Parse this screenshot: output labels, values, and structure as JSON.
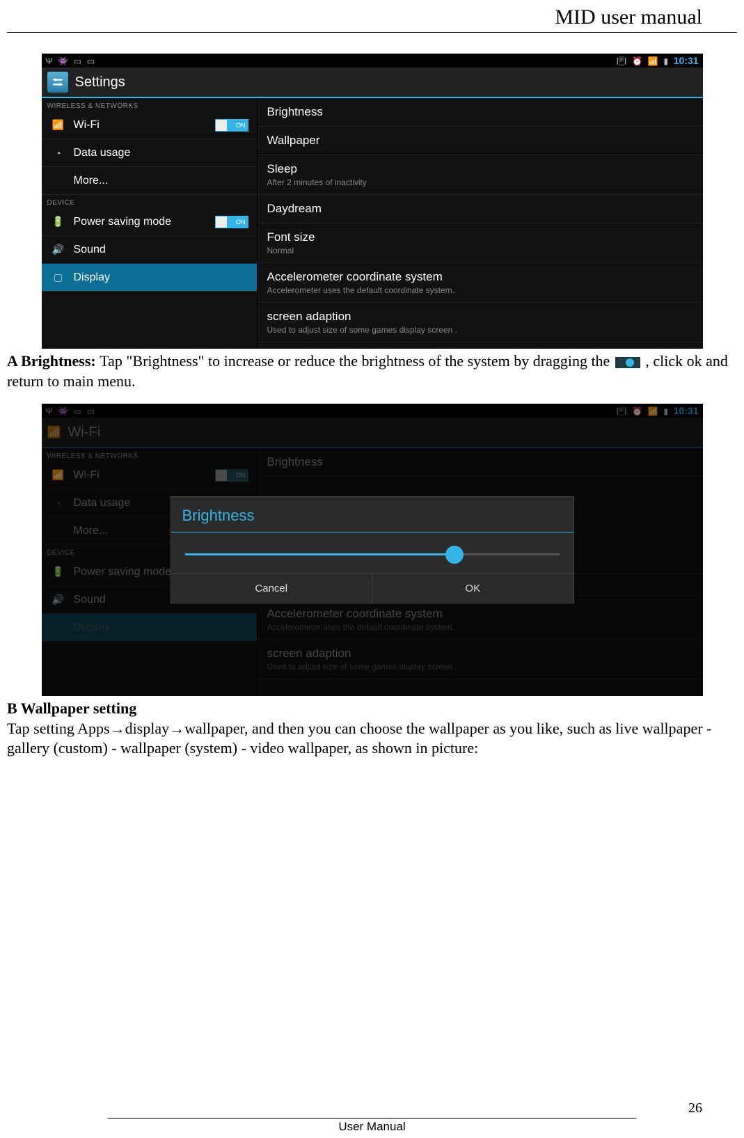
{
  "header": {
    "title": "MID user manual"
  },
  "footer": {
    "page": "26",
    "text": "User Manual"
  },
  "statusbar": {
    "time": "10:31"
  },
  "screenshot1": {
    "appTitle": "Settings",
    "sections": {
      "wireless": "WIRELESS & NETWORKS",
      "device": "DEVICE"
    },
    "sidebar": {
      "wifi": "Wi-Fi",
      "wifiSwitch": "ON",
      "data": "Data usage",
      "more": "More...",
      "power": "Power saving mode",
      "powerSwitch": "ON",
      "sound": "Sound",
      "display": "Display"
    },
    "detail": {
      "brightness": "Brightness",
      "wallpaper": "Wallpaper",
      "sleep": "Sleep",
      "sleepSub": "After 2 minutes of inactivity",
      "daydream": "Daydream",
      "fontsize": "Font size",
      "fontsizeSub": "Normal",
      "accel": "Accelerometer coordinate system",
      "accelSub": "Accelerometer uses the default coordinate system.",
      "adaption": "screen adaption",
      "adaptionSub": "Used to adjust size of some games display screen ."
    }
  },
  "paraA": {
    "bold": "A Brightness: ",
    "text1": "Tap \"Brightness\" to increase or reduce the brightness of the system by dragging the",
    "text2": ", click ok and return to main menu."
  },
  "screenshot2": {
    "appTitleItem": "Wi-Fi",
    "dialog": {
      "title": "Brightness",
      "cancel": "Cancel",
      "ok": "OK"
    }
  },
  "paraB": {
    "heading": "B Wallpaper setting",
    "text": "  Tap setting Apps→display→wallpaper, and then you can choose the wallpaper as you like, such as live wallpaper - gallery (custom) - wallpaper (system) - video wallpaper, as shown in picture:"
  }
}
